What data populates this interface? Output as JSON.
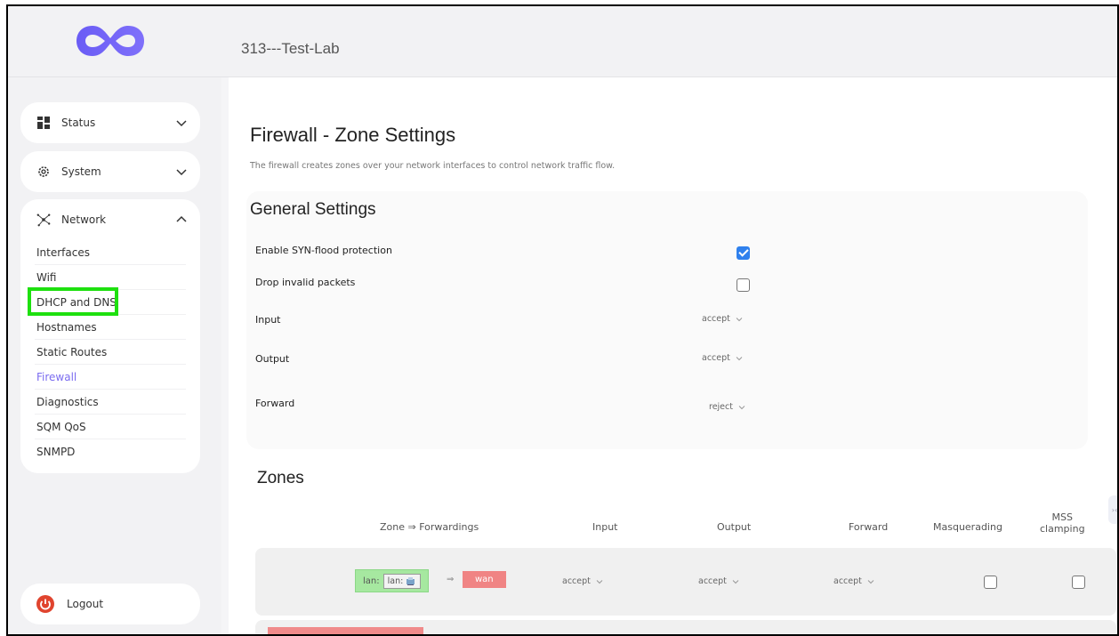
{
  "header": {
    "hostname": "313---Test-Lab"
  },
  "sidebar": {
    "status_label": "Status",
    "system_label": "System",
    "network_label": "Network",
    "network_items": [
      "Interfaces",
      "Wifi",
      "DHCP and DNS",
      "Hostnames",
      "Static Routes",
      "Firewall",
      "Diagnostics",
      "SQM QoS",
      "SNMPD"
    ],
    "active_item": "Firewall",
    "logout_label": "Logout"
  },
  "page": {
    "title": "Firewall - Zone Settings",
    "description": "The firewall creates zones over your network interfaces to control network traffic flow."
  },
  "general": {
    "title": "General Settings",
    "syn_flood_label": "Enable SYN-flood protection",
    "syn_flood_checked": true,
    "drop_invalid_label": "Drop invalid packets",
    "drop_invalid_checked": false,
    "input_label": "Input",
    "input_value": "accept",
    "output_label": "Output",
    "output_value": "accept",
    "forward_label": "Forward",
    "forward_value": "reject"
  },
  "zones": {
    "title": "Zones",
    "headers": {
      "zone": "Zone ⇒ Forwardings",
      "input": "Input",
      "output": "Output",
      "forward": "Forward",
      "masq": "Masquerading",
      "mss_1": "MSS",
      "mss_2": "clamping"
    },
    "rows": [
      {
        "zone_label": "lan:",
        "zone_inner": "lan:",
        "arrow": "⇒",
        "forward_to": "wan",
        "input": "accept",
        "output": "accept",
        "forward": "accept",
        "masquerading": false,
        "mss_clamping": false
      }
    ]
  },
  "colors": {
    "accent": "#7b6cf0",
    "highlight": "#1ee00f",
    "lan_zone": "#a6e8a0",
    "wan_zone": "#f08484",
    "checkbox": "#2f80ed"
  }
}
